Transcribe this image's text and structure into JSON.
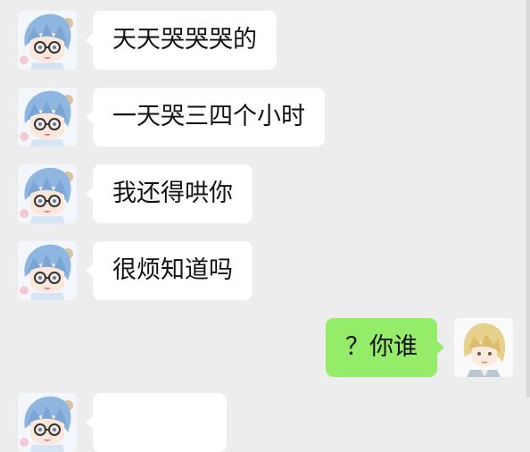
{
  "chat": {
    "messages": [
      {
        "sender": "other",
        "text": "天天哭哭哭的"
      },
      {
        "sender": "other",
        "text": "一天哭三四个小时"
      },
      {
        "sender": "other",
        "text": "我还得哄你"
      },
      {
        "sender": "other",
        "text": "很烦知道吗"
      },
      {
        "sender": "self",
        "text": "？你谁"
      }
    ]
  },
  "colors": {
    "background": "#ededed",
    "incoming_bubble": "#ffffff",
    "outgoing_bubble": "#95ec69",
    "text": "#111111"
  },
  "icons": {
    "other_avatar": "blue-hair-glasses-character-avatar",
    "self_avatar": "blonde-hair-character-avatar"
  }
}
